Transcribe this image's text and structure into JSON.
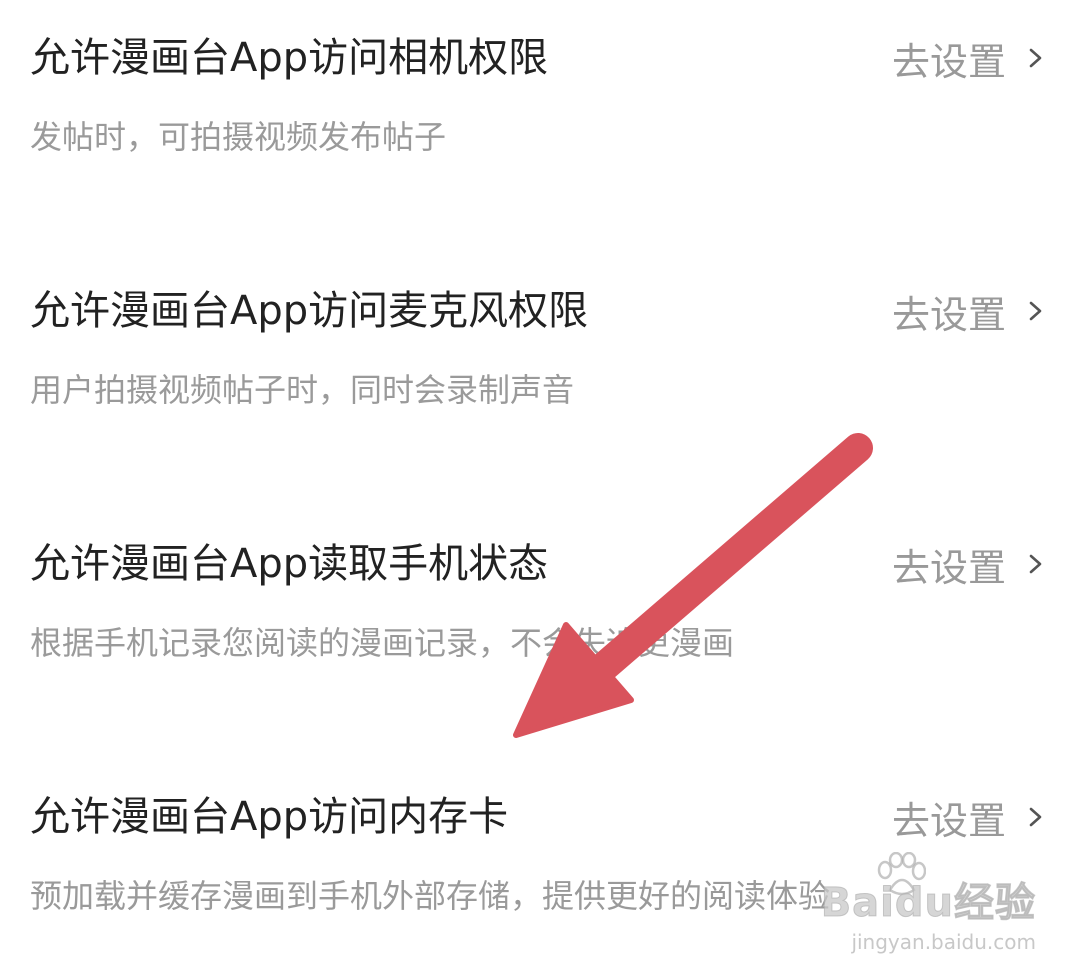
{
  "permissions": [
    {
      "title": "允许漫画台App访问相机权限",
      "description": "发帖时，可拍摄视频发布帖子",
      "action_label": "去设置"
    },
    {
      "title": "允许漫画台App访问麦克风权限",
      "description": "用户拍摄视频帖子时，同时会录制声音",
      "action_label": "去设置"
    },
    {
      "title": "允许漫画台App读取手机状态",
      "description": "根据手机记录您阅读的漫画记录，不会失追更漫画",
      "action_label": "去设置"
    },
    {
      "title": "允许漫画台App访问内存卡",
      "description": "预加载并缓存漫画到手机外部存储，提供更好的阅读体验",
      "action_label": "去设置"
    }
  ],
  "annotation": {
    "icon": "arrow-icon",
    "color": "#d9535c"
  },
  "watermark": {
    "brand": "Baidu经验",
    "url": "jingyan.baidu.com"
  }
}
